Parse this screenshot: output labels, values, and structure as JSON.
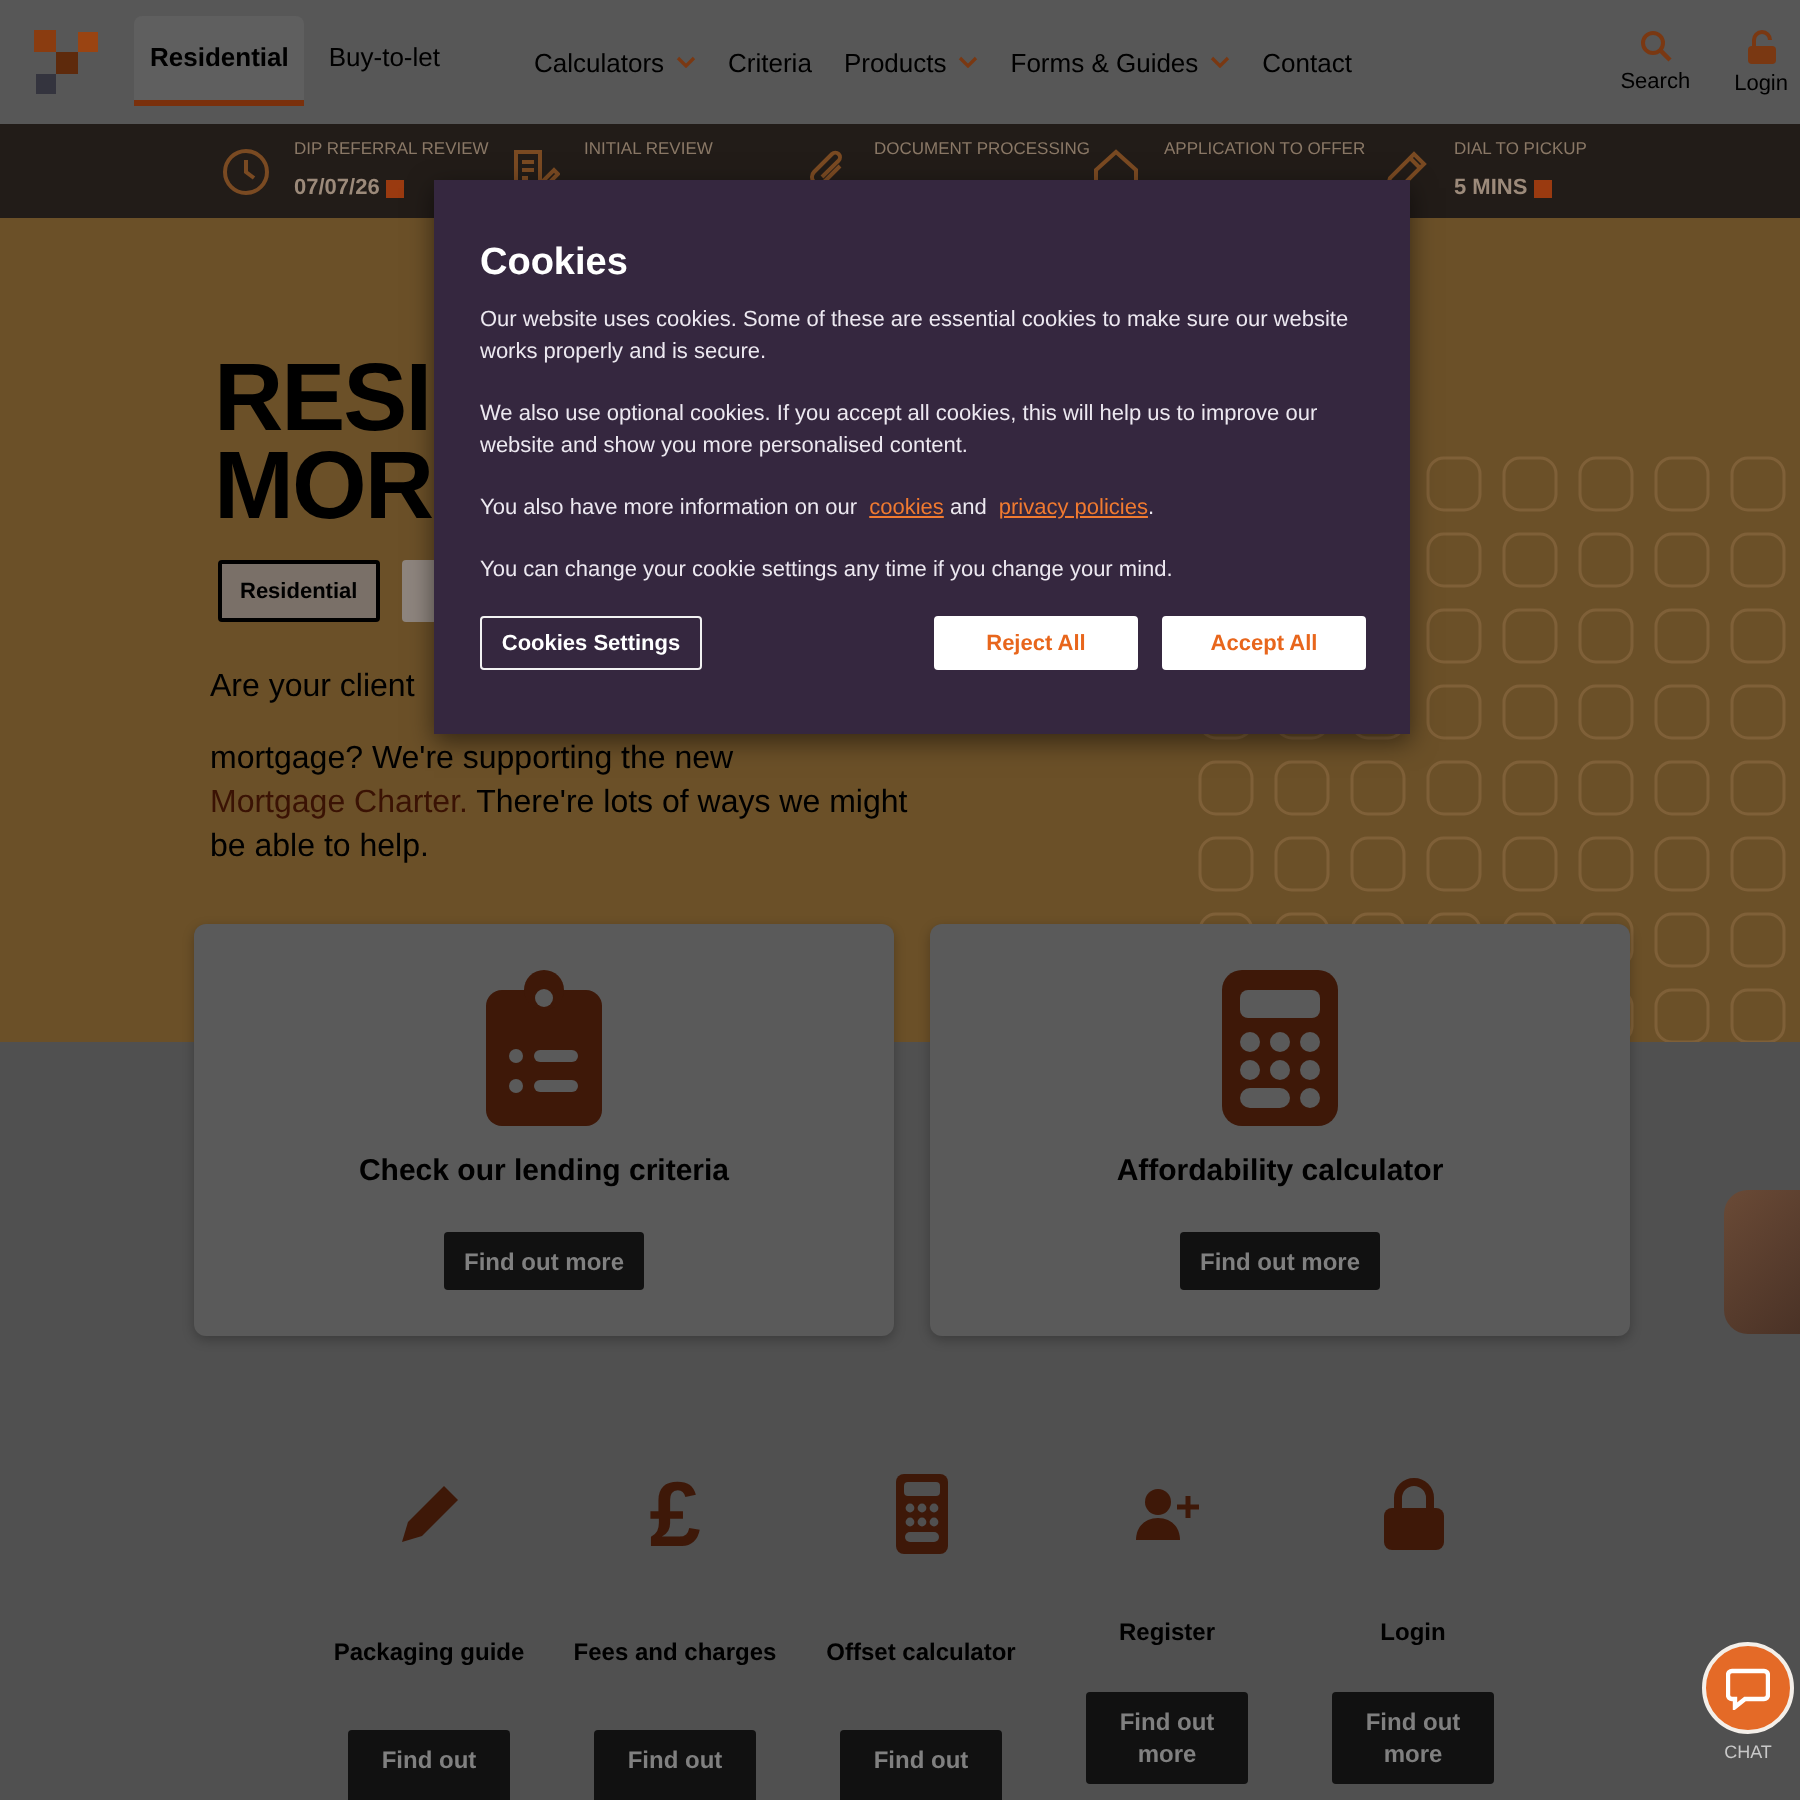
{
  "header": {
    "tabs": [
      {
        "label": "Residential",
        "selected": true
      },
      {
        "label": "Buy-to-let",
        "selected": false
      }
    ],
    "nav": [
      {
        "label": "Calculators",
        "dropdown": true
      },
      {
        "label": "Criteria",
        "dropdown": false
      },
      {
        "label": "Products",
        "dropdown": true
      },
      {
        "label": "Forms & Guides",
        "dropdown": true
      },
      {
        "label": "Contact",
        "dropdown": false
      }
    ],
    "actions": [
      {
        "label": "Search"
      },
      {
        "label": "Login"
      }
    ]
  },
  "service_levels": [
    {
      "label": "DIP REFERRAL REVIEW",
      "value": "07/07/26"
    },
    {
      "label": "INITIAL REVIEW"
    },
    {
      "label": "DOCUMENT PROCESSING"
    },
    {
      "label": "APPLICATION TO OFFER"
    },
    {
      "label": "DIAL TO PICKUP",
      "value": "5 MINS"
    }
  ],
  "hero": {
    "heading_lines": [
      "RESI",
      "MOR"
    ],
    "chips": [
      {
        "label": "Residential",
        "selected": true
      },
      {
        "selected": false
      }
    ],
    "intro_fragment": "Are your client",
    "intro": [
      {
        "kind": "text",
        "text": "mortgage? We're supporting the new "
      },
      {
        "kind": "link",
        "text": "Mortgage Charter."
      },
      {
        "kind": "text",
        "text": " There're lots of ways we might be able to help."
      }
    ]
  },
  "cards": [
    {
      "title": "Check our lending criteria",
      "button": "Find out more"
    },
    {
      "title": "Affordability calculator",
      "button": "Find out more"
    }
  ],
  "quick_links": [
    {
      "title": "Packaging guide",
      "button": "Find out"
    },
    {
      "title": "Fees and charges",
      "symbol": "£",
      "button": "Find out"
    },
    {
      "title": "Offset calculator",
      "button": "Find out"
    },
    {
      "title": "Register",
      "button": "Find out more"
    },
    {
      "title": "Login",
      "button": "Find out more"
    }
  ],
  "cookie_dialog": {
    "title": "Cookies",
    "paragraphs": [
      [
        {
          "kind": "text",
          "text": "Our website uses cookies. Some of these are essential cookies to make sure our website works properly and is secure."
        }
      ],
      [
        {
          "kind": "text",
          "text": "We also use optional cookies. If you accept all cookies, this will help us to improve our website and show you more personalised content."
        }
      ],
      [
        {
          "kind": "text",
          "text": "You also have more information on our "
        },
        {
          "kind": "link",
          "text": "cookies"
        },
        {
          "kind": "text",
          "text": " and "
        },
        {
          "kind": "link",
          "text": "privacy policies"
        },
        {
          "kind": "text",
          "text": "."
        }
      ],
      [
        {
          "kind": "text",
          "text": "You can change your cookie settings any time if you change your mind."
        }
      ]
    ],
    "buttons": [
      {
        "label": "Cookies Settings",
        "kind": "outline"
      },
      {
        "label": "Reject All",
        "kind": "solid"
      },
      {
        "label": "Accept All",
        "kind": "solid"
      }
    ]
  },
  "chat": {
    "label": "CHAT"
  }
}
